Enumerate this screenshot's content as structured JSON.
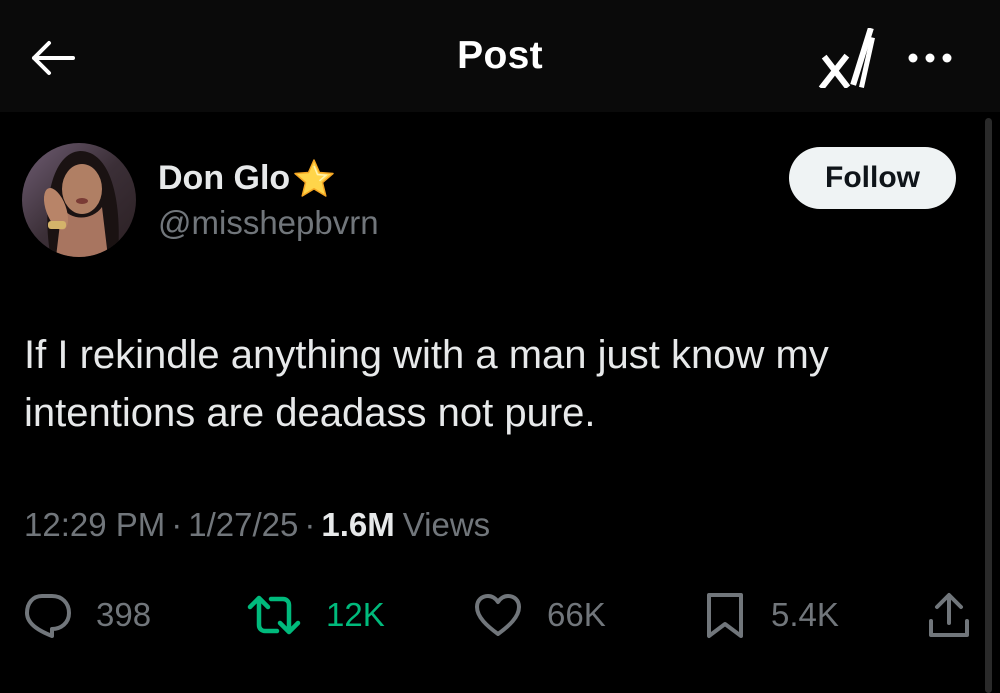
{
  "header": {
    "title": "Post",
    "back_icon": "arrow-left-icon",
    "grok_icon": "grok-icon",
    "more_icon": "more-horizontal-icon"
  },
  "author": {
    "display_name": "Don Glo",
    "badge_icon": "star-emoji-icon",
    "handle": "@misshepbvrn",
    "follow_label": "Follow"
  },
  "post": {
    "text": "If I rekindle anything with a man just know my intentions are deadass not pure.",
    "time": "12:29 PM",
    "date": "1/27/25",
    "separator": "·",
    "views_count": "1.6M",
    "views_label": "Views"
  },
  "actions": {
    "replies": "398",
    "reposts": "12K",
    "likes": "66K",
    "bookmarks": "5.4K"
  },
  "colors": {
    "background": "#000000",
    "text_primary": "#e7e9ea",
    "text_secondary": "#71767b",
    "repost_active": "#00ba7c",
    "follow_bg": "#eff3f4"
  }
}
